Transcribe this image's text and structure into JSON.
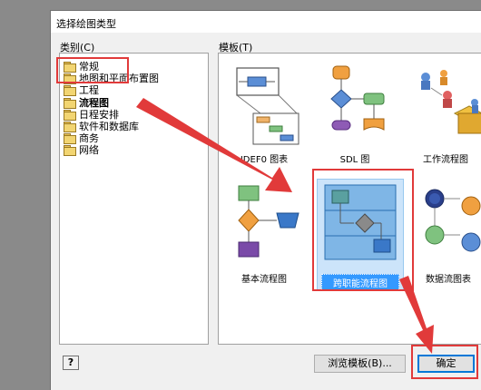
{
  "window": {
    "title": "选择绘图类型"
  },
  "category": {
    "label": "类别(C)",
    "items": [
      {
        "label": "常规",
        "selected": false
      },
      {
        "label": "地图和平面布置图",
        "selected": false
      },
      {
        "label": "工程",
        "selected": false
      },
      {
        "label": "流程图",
        "selected": true
      },
      {
        "label": "日程安排",
        "selected": false
      },
      {
        "label": "软件和数据库",
        "selected": false
      },
      {
        "label": "商务",
        "selected": false
      },
      {
        "label": "网络",
        "selected": false
      }
    ]
  },
  "templates": {
    "label": "模板(T)",
    "items": [
      {
        "label": "IDEF0 图表",
        "selected": false
      },
      {
        "label": "SDL 图",
        "selected": false
      },
      {
        "label": "工作流程图",
        "selected": false
      },
      {
        "label": "基本流程图",
        "selected": false
      },
      {
        "label": "跨职能流程图",
        "selected": true
      },
      {
        "label": "数据流图表",
        "selected": false
      }
    ]
  },
  "buttons": {
    "help": "?",
    "browse": "浏览模板(B)...",
    "ok": "确定"
  },
  "colors": {
    "annotation": "#e13a3a",
    "selection": "#3399ff"
  }
}
